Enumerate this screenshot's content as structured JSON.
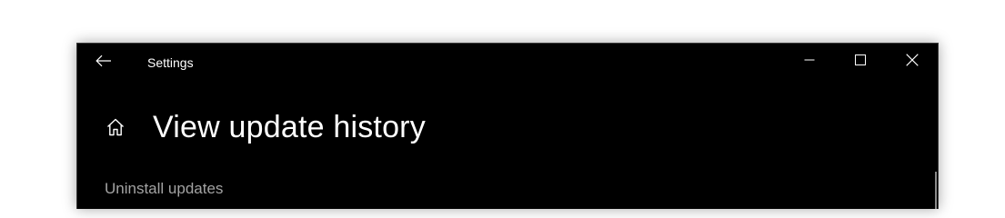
{
  "window": {
    "title": "Settings",
    "background": "#000000"
  },
  "titlebar": {
    "back_icon": "back-arrow-icon",
    "minimize_icon": "minimize-icon",
    "maximize_icon": "maximize-icon",
    "close_icon": "close-icon"
  },
  "header": {
    "home_icon": "home-icon",
    "title": "View update history"
  },
  "main": {
    "uninstall_link": "Uninstall updates"
  }
}
